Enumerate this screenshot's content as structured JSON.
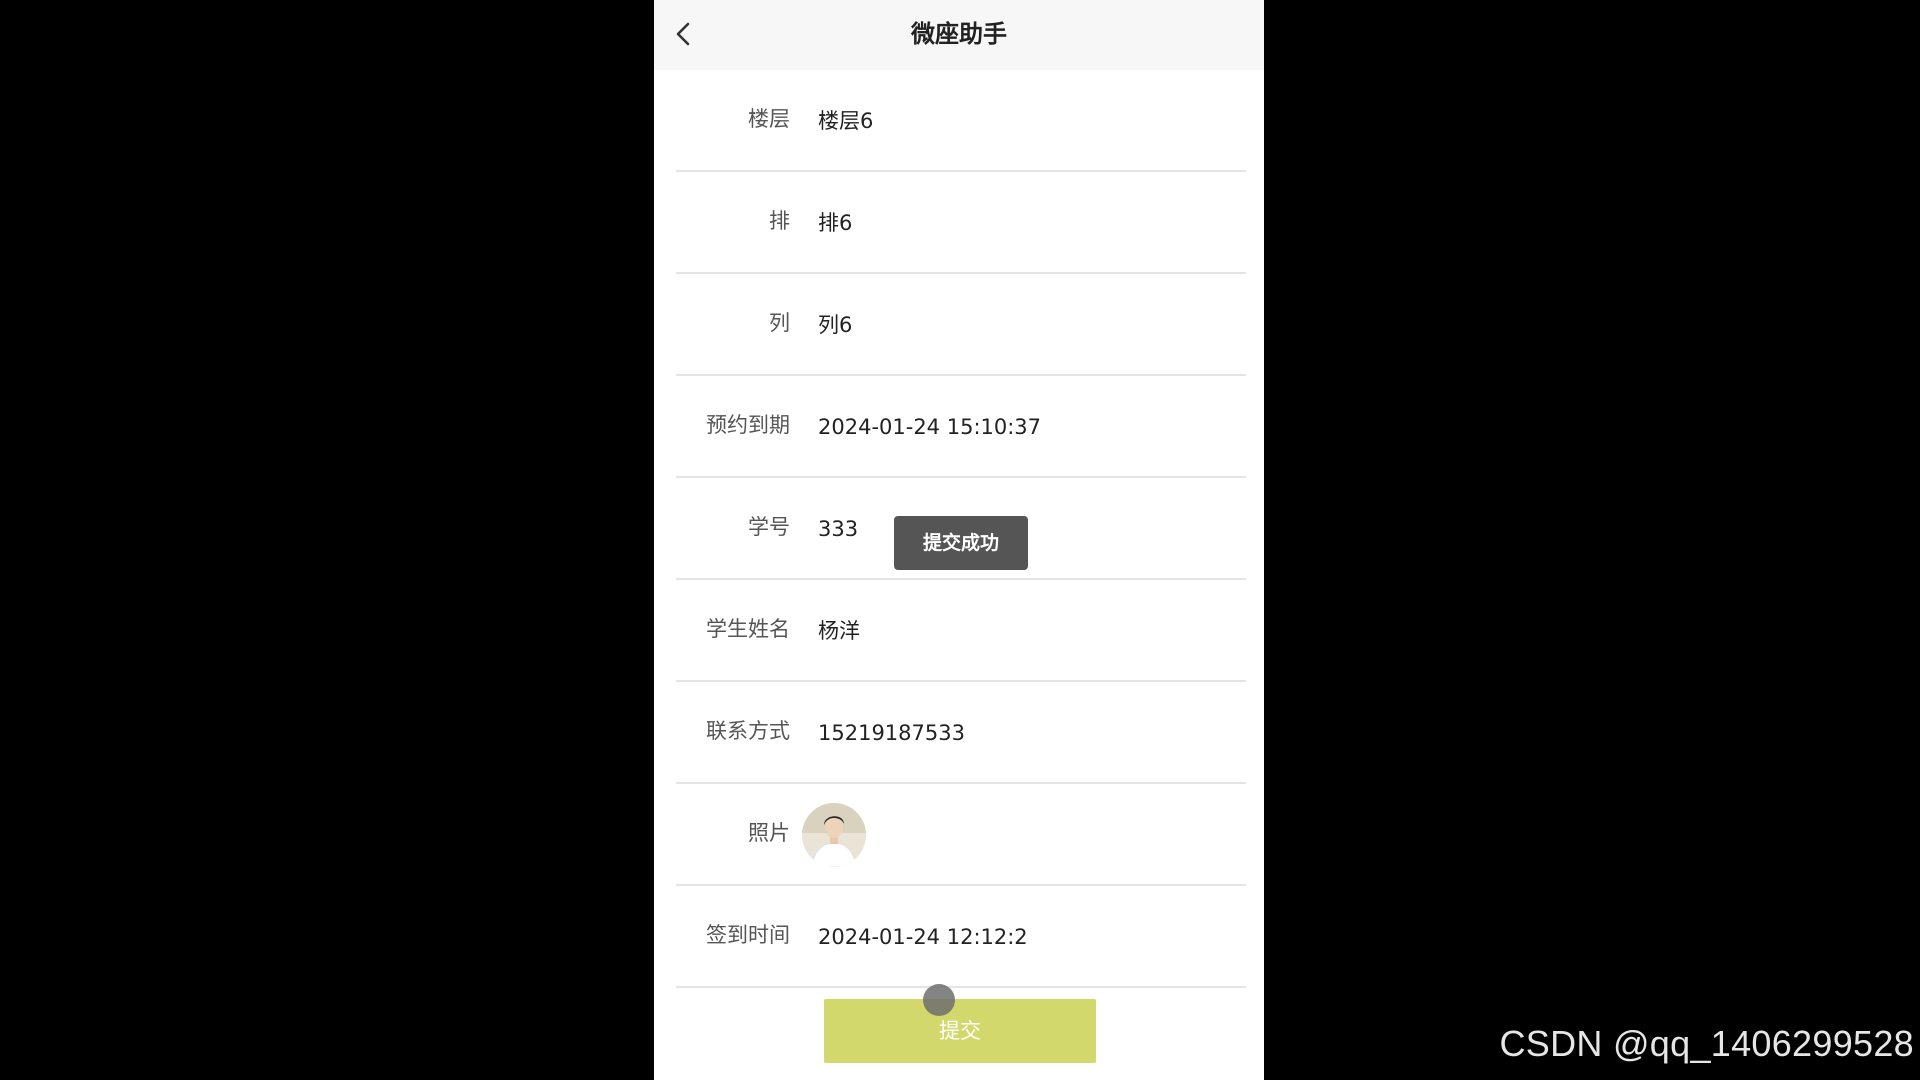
{
  "navbar": {
    "title": "微座助手",
    "back_icon": "chevron-left-icon"
  },
  "form": {
    "floor": {
      "label": "楼层",
      "value": "楼层6"
    },
    "row": {
      "label": "排",
      "value": "排6"
    },
    "column": {
      "label": "列",
      "value": "列6"
    },
    "expiry": {
      "label": "预约到期",
      "value": "2024-01-24 15:10:37"
    },
    "student_id": {
      "label": "学号",
      "value": "333"
    },
    "student_name": {
      "label": "学生姓名",
      "value": "杨洋"
    },
    "contact": {
      "label": "联系方式",
      "value": "15219187533"
    },
    "photo": {
      "label": "照片"
    },
    "checkin_time": {
      "label": "签到时间",
      "value": "2024-01-24 12:12:2"
    }
  },
  "toast": {
    "text": "提交成功"
  },
  "submit": {
    "label": "提交"
  },
  "watermark": {
    "text": "CSDN @qq_1406299528"
  },
  "colors": {
    "submit_bg": "#d3d86c",
    "toast_bg": "#555555",
    "navbar_bg": "#f7f7f7"
  }
}
